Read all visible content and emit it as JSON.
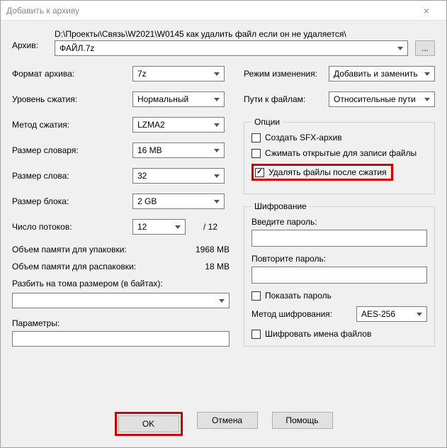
{
  "window": {
    "title": "Добавить к архиву"
  },
  "archive": {
    "label": "Архив:",
    "path": "D:\\Проекты\\Связь\\W2021\\W0145 как удалить файл если он не удаляется\\",
    "filename": "ФАЙЛ.7z",
    "browse": "..."
  },
  "left": {
    "format_label": "Формат архива:",
    "format_value": "7z",
    "level_label": "Уровень сжатия:",
    "level_value": "Нормальный",
    "method_label": "Метод сжатия:",
    "method_value": "LZMA2",
    "dict_label": "Размер словаря:",
    "dict_value": "16 MB",
    "word_label": "Размер слова:",
    "word_value": "32",
    "block_label": "Размер блока:",
    "block_value": "2 GB",
    "threads_label": "Число потоков:",
    "threads_value": "12",
    "threads_max": "/ 12",
    "mem_pack_label": "Объем памяти для упаковки:",
    "mem_pack_value": "1968 MB",
    "mem_unpack_label": "Объем памяти для распаковки:",
    "mem_unpack_value": "18 MB",
    "split_label": "Разбить на тома размером (в байтах):",
    "params_label": "Параметры:"
  },
  "right": {
    "mode_label": "Режим изменения:",
    "mode_value": "Добавить и заменить",
    "paths_label": "Пути к файлам:",
    "paths_value": "Относительные пути",
    "options_legend": "Опции",
    "opt_sfx": "Создать SFX-архив",
    "opt_shared": "Сжимать открытые для записи файлы",
    "opt_delete": "Удалять файлы после сжатия",
    "enc_legend": "Шифрование",
    "pwd_label": "Введите пароль:",
    "pwd2_label": "Повторите пароль:",
    "show_pwd": "Показать пароль",
    "enc_method_label": "Метод шифрования:",
    "enc_method_value": "AES-256",
    "enc_names": "Шифровать имена файлов"
  },
  "buttons": {
    "ok": "OK",
    "cancel": "Отмена",
    "help": "Помощь"
  }
}
